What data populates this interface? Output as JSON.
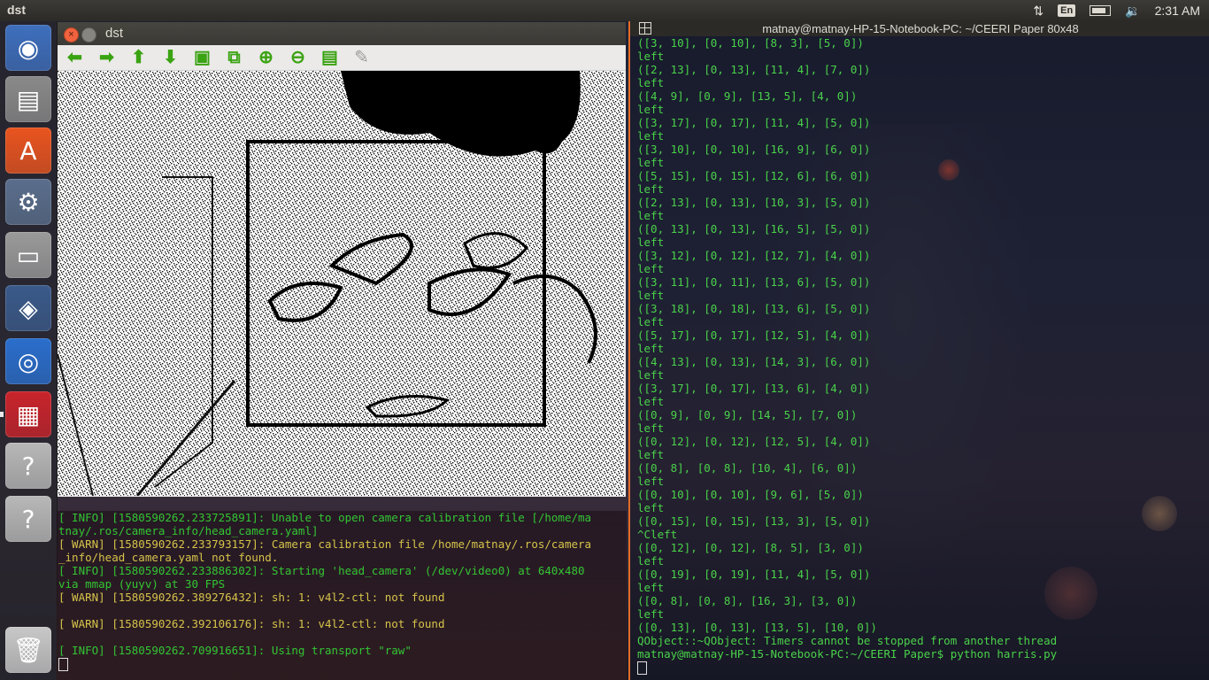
{
  "top_panel": {
    "active_app": "dst",
    "keyboard_layout": "En",
    "clock": "2:31 AM",
    "icons": [
      "network-transfer-icon",
      "keyboard-layout-icon",
      "battery-icon",
      "volume-icon"
    ]
  },
  "launcher": {
    "items": [
      {
        "name": "ubuntu-dash-icon",
        "glyph": "◉",
        "color": "#3e6fbd"
      },
      {
        "name": "files-icon",
        "glyph": "▤",
        "color": "#8a8a8a"
      },
      {
        "name": "software-center-icon",
        "glyph": "A",
        "color": "#e9541f"
      },
      {
        "name": "system-settings-icon",
        "glyph": "⚙",
        "color": "#5a6e8c"
      },
      {
        "name": "disks-icon",
        "glyph": "▭",
        "color": "#9a9a9a"
      },
      {
        "name": "virtualbox-icon",
        "glyph": "◈",
        "color": "#3a5a8a"
      },
      {
        "name": "chromium-icon",
        "glyph": "◎",
        "color": "#2a6ecc"
      },
      {
        "name": "app-red-icon",
        "glyph": "▦",
        "color": "#c9242b"
      },
      {
        "name": "unknown-app-icon",
        "glyph": "?",
        "color": "#b8b8b8"
      },
      {
        "name": "unknown-app-icon-2",
        "glyph": "?",
        "color": "#b8b8b8"
      },
      {
        "name": "trash-icon",
        "glyph": "🗑",
        "color": "#c8c8c8"
      }
    ]
  },
  "viewer": {
    "title": "dst",
    "toolbar": [
      {
        "name": "back-icon",
        "glyph": "⬅",
        "enabled": true
      },
      {
        "name": "forward-icon",
        "glyph": "➡",
        "enabled": true
      },
      {
        "name": "up-icon",
        "glyph": "⬆",
        "enabled": true
      },
      {
        "name": "down-icon",
        "glyph": "⬇",
        "enabled": true
      },
      {
        "name": "image-icon",
        "glyph": "▣",
        "enabled": true
      },
      {
        "name": "zoom-fit-icon",
        "glyph": "⧉",
        "enabled": true
      },
      {
        "name": "zoom-in-icon",
        "glyph": "⊕",
        "enabled": true
      },
      {
        "name": "zoom-out-icon",
        "glyph": "⊖",
        "enabled": true
      },
      {
        "name": "save-icon",
        "glyph": "▤",
        "enabled": true
      },
      {
        "name": "brush-icon",
        "glyph": "✎",
        "enabled": false
      }
    ]
  },
  "term_left": {
    "lines": [
      {
        "type": "info",
        "text": "[ INFO] [1580590262.233725891]: Unable to open camera calibration file [/home/ma"
      },
      {
        "type": "info",
        "text": "tnay/.ros/camera_info/head_camera.yaml]"
      },
      {
        "type": "warn",
        "text": "[ WARN] [1580590262.233793157]: Camera calibration file /home/matnay/.ros/camera"
      },
      {
        "type": "warn",
        "text": "_info/head_camera.yaml not found."
      },
      {
        "type": "info",
        "text": "[ INFO] [1580590262.233886302]: Starting 'head_camera' (/dev/video0) at 640x480"
      },
      {
        "type": "info",
        "text": "via mmap (yuyv) at 30 FPS"
      },
      {
        "type": "warn",
        "text": "[ WARN] [1580590262.389276432]: sh: 1: v4l2-ctl: not found"
      },
      {
        "type": "warn",
        "text": ""
      },
      {
        "type": "warn",
        "text": "[ WARN] [1580590262.392106176]: sh: 1: v4l2-ctl: not found"
      },
      {
        "type": "info",
        "text": ""
      },
      {
        "type": "info",
        "text": "[ INFO] [1580590262.709916651]: Using transport \"raw\""
      }
    ]
  },
  "term_right": {
    "title": "matnay@matnay-HP-15-Notebook-PC: ~/CEERI Paper 80x48",
    "lines": [
      "([3, 10], [0, 10], [8, 3], [5, 0])",
      "left",
      "([2, 13], [0, 13], [11, 4], [7, 0])",
      "left",
      "([4, 9], [0, 9], [13, 5], [4, 0])",
      "left",
      "([3, 17], [0, 17], [11, 4], [5, 0])",
      "left",
      "([3, 10], [0, 10], [16, 9], [6, 0])",
      "left",
      "([5, 15], [0, 15], [12, 6], [6, 0])",
      "left",
      "([2, 13], [0, 13], [10, 3], [5, 0])",
      "left",
      "([0, 13], [0, 13], [16, 5], [5, 0])",
      "left",
      "([3, 12], [0, 12], [12, 7], [4, 0])",
      "left",
      "([3, 11], [0, 11], [13, 6], [5, 0])",
      "left",
      "([3, 18], [0, 18], [13, 6], [5, 0])",
      "left",
      "([5, 17], [0, 17], [12, 5], [4, 0])",
      "left",
      "([4, 13], [0, 13], [14, 3], [6, 0])",
      "left",
      "([3, 17], [0, 17], [13, 6], [4, 0])",
      "left",
      "([0, 9], [0, 9], [14, 5], [7, 0])",
      "left",
      "([0, 12], [0, 12], [12, 5], [4, 0])",
      "left",
      "([0, 8], [0, 8], [10, 4], [6, 0])",
      "left",
      "([0, 10], [0, 10], [9, 6], [5, 0])",
      "left",
      "([0, 15], [0, 15], [13, 3], [5, 0])",
      "^Cleft",
      "([0, 12], [0, 12], [8, 5], [3, 0])",
      "left",
      "([0, 19], [0, 19], [11, 4], [5, 0])",
      "left",
      "([0, 8], [0, 8], [16, 3], [3, 0])",
      "left",
      "([0, 13], [0, 13], [13, 5], [10, 0])",
      "QObject::~QObject: Timers cannot be stopped from another thread",
      "matnay@matnay-HP-15-Notebook-PC:~/CEERI Paper$ python harris.py"
    ]
  }
}
